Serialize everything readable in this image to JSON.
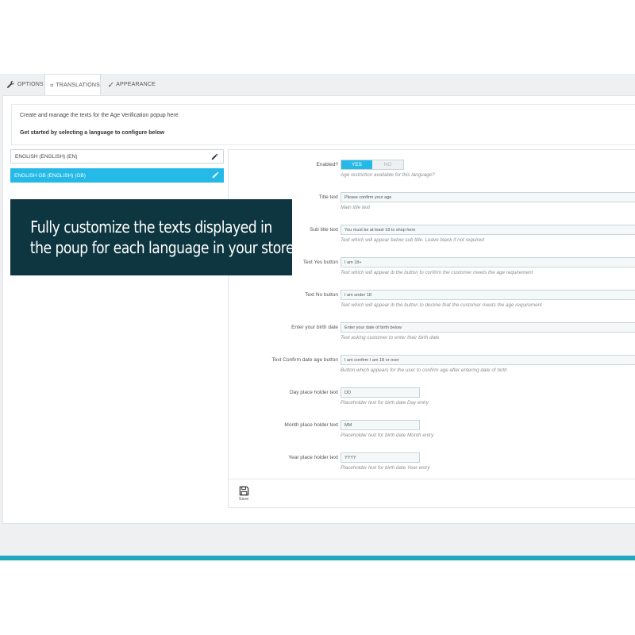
{
  "tabs": [
    {
      "label": "Options",
      "icon": "wrench-icon"
    },
    {
      "label": "Translations",
      "icon": "external-link-icon"
    },
    {
      "label": "Appearance",
      "icon": "brush-icon"
    }
  ],
  "intro": {
    "line1": "Create and manage the texts for the Age Verification popup here.",
    "line2": "Get started by selecting a language to configure below"
  },
  "languages": [
    {
      "label": "ENGLISH (ENGLISH) (EN)",
      "active": false
    },
    {
      "label": "ENGLISH GB (ENGLISH) (GB)",
      "active": true
    }
  ],
  "form": {
    "enabled": {
      "label": "Enabled?",
      "yes": "YES",
      "no": "NO",
      "help": "Age restriction available for this language?"
    },
    "fields": [
      {
        "label": "Title text",
        "value": "Please confirm your age",
        "help": "Main title text"
      },
      {
        "label": "Sub title text",
        "value": "You must be at least 18 to shop here",
        "help": "Text which will appear below sub title. Leave blank if not required"
      },
      {
        "label": "Text Yes button",
        "value": "I am 18+",
        "help": "Text which will appear ib the button to confirm the customer meets the age requirement"
      },
      {
        "label": "Text No button",
        "value": "I am under 18",
        "help": "Text which will appear ib the button to decline that the customer meets the age requirement"
      },
      {
        "label": "Enter your birth date",
        "value": "Enter your date of birth below",
        "help": "Text asking customer to enter their birth date"
      },
      {
        "label": "Text Confirm date age button",
        "value": "I am confirm I am 18 or over",
        "help": "Button which appears for the user to confirm age after entering date of birth"
      },
      {
        "label": "Day place holder text",
        "value": "DD",
        "help": "Placeholder text for birth date Day entry"
      },
      {
        "label": "Month place holder text",
        "value": "MM",
        "help": "Placeholder text for birth date Month entry"
      },
      {
        "label": "Year place holder text",
        "value": "YYYY",
        "help": "Placeholder text for birth date Year entry"
      }
    ],
    "save_label": "Save"
  },
  "overlay": {
    "line1": "Fully customize the texts displayed in",
    "line2": "the poup for each language in your store"
  },
  "colors": {
    "accent": "#25b9e8",
    "overlay_bg": "#0e3640",
    "bottom_bar": "#1fa8bf"
  }
}
